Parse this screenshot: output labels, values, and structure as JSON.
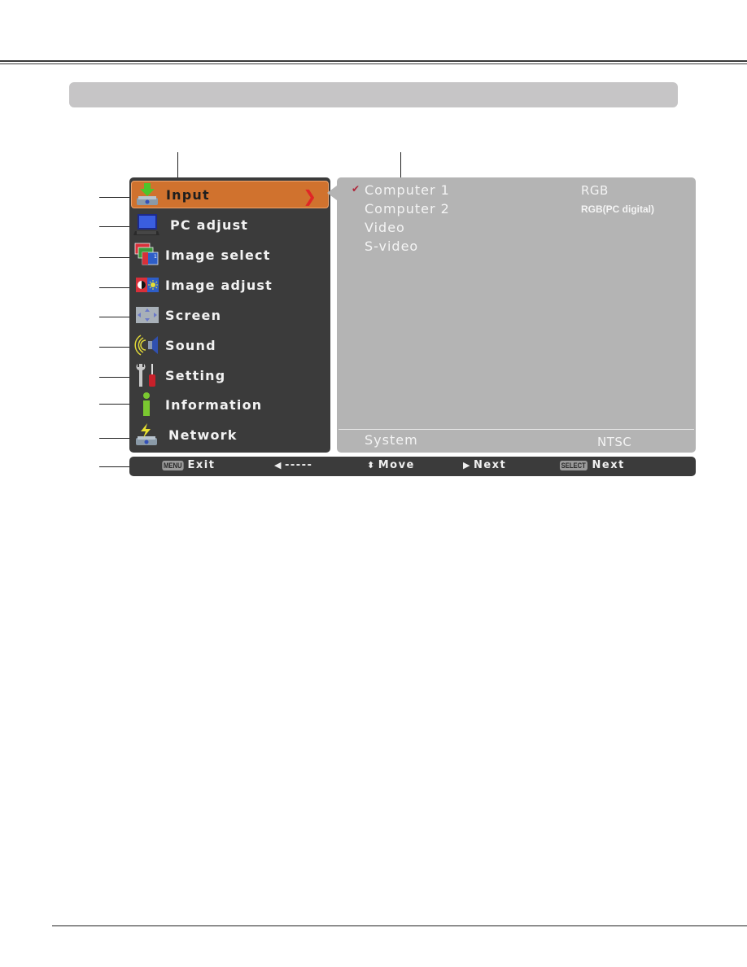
{
  "document": {
    "section_title_bar": ""
  },
  "main_menu": {
    "items": [
      {
        "label": "Input",
        "icon": "input-icon",
        "active": true
      },
      {
        "label": "PC adjust",
        "icon": "pc-adjust-icon"
      },
      {
        "label": "Image select",
        "icon": "image-select-icon"
      },
      {
        "label": "Image adjust",
        "icon": "image-adjust-icon"
      },
      {
        "label": "Screen",
        "icon": "screen-icon"
      },
      {
        "label": "Sound",
        "icon": "sound-icon"
      },
      {
        "label": "Setting",
        "icon": "setting-icon"
      },
      {
        "label": "Information",
        "icon": "information-icon"
      },
      {
        "label": "Network",
        "icon": "network-icon"
      }
    ],
    "active_arrow": "❯"
  },
  "sub_menu": {
    "items": [
      {
        "label": "Computer 1",
        "value": "RGB",
        "selected": true
      },
      {
        "label": "Computer 2",
        "value": "RGB(PC digital)"
      },
      {
        "label": "Video",
        "value": ""
      },
      {
        "label": "S-video",
        "value": ""
      }
    ],
    "check_mark": "✔",
    "system": {
      "label": "System",
      "value": "NTSC"
    }
  },
  "footer": {
    "exit": {
      "key": "MENU",
      "label": "Exit"
    },
    "back": {
      "glyph": "◀",
      "label": "-----"
    },
    "move": {
      "glyph": "⬍",
      "label": "Move"
    },
    "next": {
      "glyph": "▶",
      "label": "Next"
    },
    "select": {
      "key": "SELECT",
      "label": "Next"
    }
  },
  "colors": {
    "menu_bg": "#3b3b3b",
    "active_item": "#d0722e",
    "submenu_bg": "#b4b4b4",
    "title_bar": "#c6c5c6",
    "arrow": "#e02626"
  }
}
